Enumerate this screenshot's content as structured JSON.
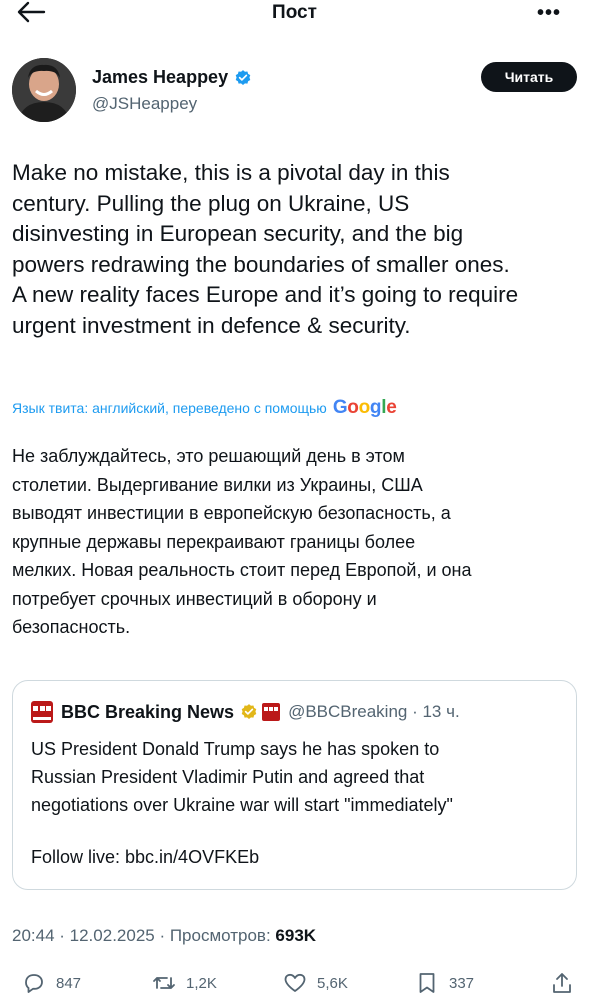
{
  "header": {
    "title": "Пост",
    "more": "•••"
  },
  "author": {
    "name": "James Heappey",
    "handle": "@JSHeappey",
    "follow_label": "Читать"
  },
  "tweet": {
    "lines": [
      "Make no mistake, this is a pivotal day in this",
      "century. Pulling the plug on Ukraine, US",
      "disinvesting in European security, and the big",
      "powers redrawing the boundaries of smaller ones.",
      "A new reality faces Europe and it’s going to require",
      "urgent investment in defence & security."
    ],
    "translation_note": "Язык твита: английский, переведено с помощью",
    "google": [
      "G",
      "o",
      "o",
      "g",
      "l",
      "e"
    ],
    "translated_lines": [
      "Не заблуждайтесь, это решающий день в этом",
      "столетии. Выдергивание вилки из Украины, США",
      "выводят инвестиции в европейскую безопасность, а",
      "крупные державы перекраивают границы более",
      "мелких. Новая реальность стоит перед Европой, и она",
      "потребует срочных инвестиций в оборону и",
      "безопасность."
    ]
  },
  "quote": {
    "name": "BBC Breaking News",
    "handle": "@BBCBreaking · 13 ч.",
    "lines": [
      "US President Donald Trump says he has spoken to",
      "Russian President Vladimir Putin and agreed that",
      "negotiations over Ukraine war will start \"immediately\""
    ],
    "follow_live": "Follow live: bbc.in/4OVFKEb"
  },
  "meta": {
    "prefix": "20:44 · 12.02.2025 · Просмотров: ",
    "views": "693K"
  },
  "actions": {
    "replies": "847",
    "reposts": "1,2K",
    "likes": "5,6K",
    "bookmarks": "337"
  },
  "colors": {
    "link": "#1d9bf0",
    "bbc_red": "#bb1919",
    "verified_blue": "#1d9bf0",
    "gold": "#e2b719"
  }
}
